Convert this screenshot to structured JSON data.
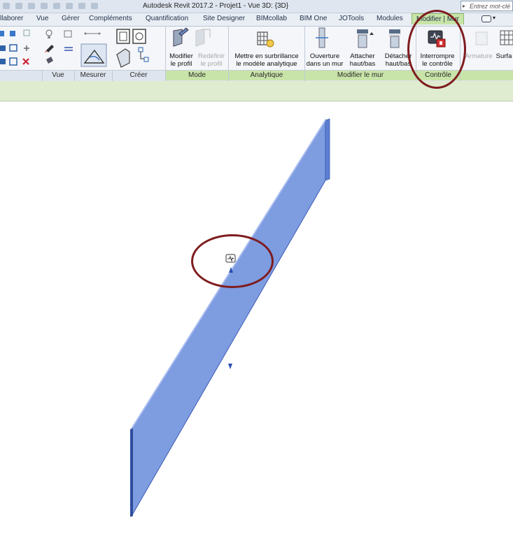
{
  "window": {
    "title": "Autodesk Revit 2017.2 -    Projet1 - Vue 3D: {3D}",
    "search_placeholder": "Entrez mot-clé"
  },
  "tabs": [
    {
      "label": "llaborer"
    },
    {
      "label": "Vue"
    },
    {
      "label": "Gérer"
    },
    {
      "label": "Compléments"
    },
    {
      "label": "Quantification"
    },
    {
      "label": "Site Designer"
    },
    {
      "label": "BIMcollab"
    },
    {
      "label": "BIM One"
    },
    {
      "label": "JOTools"
    },
    {
      "label": "Modules"
    },
    {
      "label": "Modifier | Mur",
      "active": true
    }
  ],
  "panels": {
    "vue": "Vue",
    "mesurer": "Mesurer",
    "creer": "Créer",
    "mode": "Mode",
    "analytique": "Analytique",
    "modifier_le_mur": "Modifier le mur",
    "controle": "Contrôle"
  },
  "buttons": {
    "modifier_profil": [
      "Modifier",
      "le profil"
    ],
    "redefinir_profil": [
      "Redéfinir",
      "le profil"
    ],
    "surbrillance": [
      "Mettre en surbrillance",
      "le modèle analytique"
    ],
    "ouverture": [
      "Ouverture",
      "dans un mur"
    ],
    "attacher": [
      "Attacher",
      "haut/bas"
    ],
    "detacher": [
      "Détacher",
      "haut/bas"
    ],
    "interrompre": [
      "Interrompre",
      "le contrôle"
    ],
    "armature": "Armature",
    "surface": "Surfa"
  },
  "colors": {
    "wall_face": "#7e9ce0",
    "wall_edge": "#3d5bb3",
    "annotation_ring": "#7e1c1f",
    "active_tab": "#c8e4a8"
  }
}
